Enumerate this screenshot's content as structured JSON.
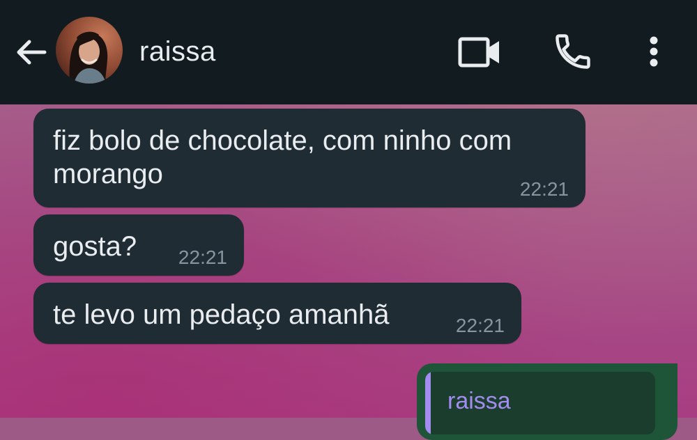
{
  "header": {
    "contact_name": "raissa",
    "back_icon": "arrow-left-icon",
    "avatar": "contact-avatar",
    "actions": [
      {
        "icon": "video-call-icon"
      },
      {
        "icon": "phone-call-icon"
      },
      {
        "icon": "more-vertical-icon"
      }
    ],
    "background_color": "#111b20"
  },
  "messages": [
    {
      "direction": "incoming",
      "text": "fiz bolo de chocolate, com ninho com morango",
      "time": "22:21"
    },
    {
      "direction": "incoming",
      "text": "gosta?",
      "time": "22:21"
    },
    {
      "direction": "incoming",
      "text": "te levo um pedaço amanhã",
      "time": "22:21"
    }
  ],
  "outgoing_preview": {
    "direction": "outgoing",
    "quoted_author": "raissa"
  },
  "colors": {
    "incoming_bubble": "#1f2c34",
    "outgoing_bubble": "#1e5438",
    "quote_accent": "#a38cf0",
    "timestamp": "#8696a0",
    "text": "#e9edef"
  }
}
